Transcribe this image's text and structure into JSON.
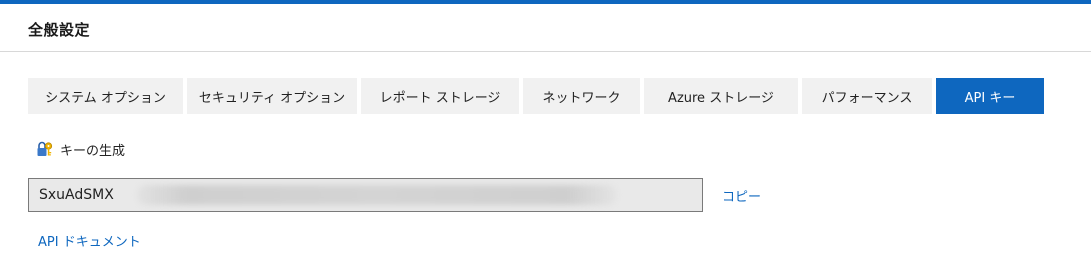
{
  "header": {
    "title": "全般設定"
  },
  "tabs": [
    {
      "label": "システム オプション",
      "active": false
    },
    {
      "label": "セキュリティ オプション",
      "active": false
    },
    {
      "label": "レポート ストレージ",
      "active": false
    },
    {
      "label": "ネットワーク",
      "active": false
    },
    {
      "label": "Azure ストレージ",
      "active": false
    },
    {
      "label": "パフォーマンス",
      "active": false
    },
    {
      "label": "API キー",
      "active": true
    }
  ],
  "api_key": {
    "generate_label": "キーの生成",
    "generate_icon": "lock-key-icon",
    "value_visible_prefix": "SxuAdSMX",
    "copy_label": "コピー",
    "docs_link_label": "API ドキュメント"
  },
  "colors": {
    "accent": "#0e67bf",
    "tab_inactive_bg": "#f1f1f1",
    "field_bg": "#e9e9e9"
  }
}
